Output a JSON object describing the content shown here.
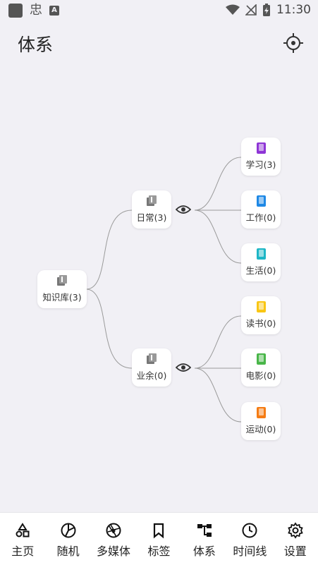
{
  "status": {
    "time": "11:30",
    "left_glyph": "忠",
    "a_badge": "A"
  },
  "appbar": {
    "title": "体系"
  },
  "map": {
    "root": {
      "label": "知识库(3)",
      "icon": "library-icon"
    },
    "branches": [
      {
        "label": "日常(3)",
        "icon": "library-icon",
        "children": [
          {
            "label": "学习(3)",
            "color": "#8e35d6"
          },
          {
            "label": "工作(0)",
            "color": "#1e88e5"
          },
          {
            "label": "生活(0)",
            "color": "#1db6c6"
          }
        ]
      },
      {
        "label": "业余(0)",
        "icon": "library-icon",
        "children": [
          {
            "label": "读书(0)",
            "color": "#f9c614"
          },
          {
            "label": "电影(0)",
            "color": "#49b649"
          },
          {
            "label": "运动(0)",
            "color": "#f57c14"
          }
        ]
      }
    ]
  },
  "nav": {
    "items": [
      {
        "label": "主页",
        "icon": "shapes-icon"
      },
      {
        "label": "随机",
        "icon": "aperture-icon"
      },
      {
        "label": "多媒体",
        "icon": "shutter-icon"
      },
      {
        "label": "标签",
        "icon": "bookmark-icon"
      },
      {
        "label": "体系",
        "icon": "hierarchy-icon"
      },
      {
        "label": "时间线",
        "icon": "clock-icon"
      },
      {
        "label": "设置",
        "icon": "gear-icon"
      }
    ]
  }
}
